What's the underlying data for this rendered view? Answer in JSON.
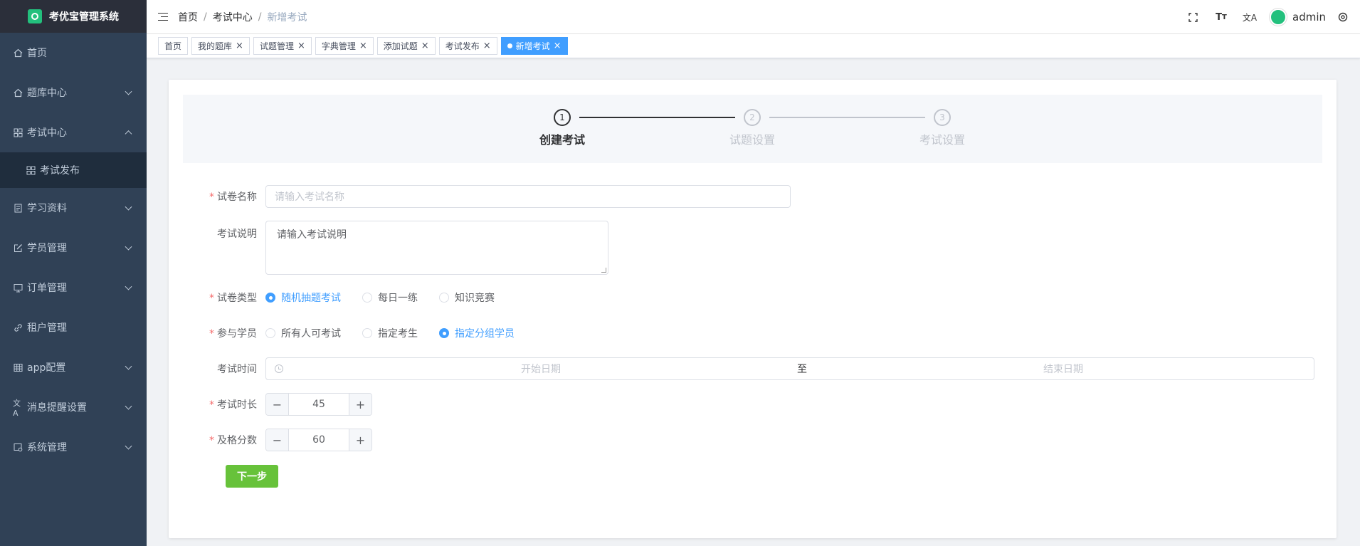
{
  "app": {
    "title": "考优宝管理系统"
  },
  "sidebar": {
    "items": [
      {
        "label": "首页",
        "icon": "home-icon"
      },
      {
        "label": "题库中心",
        "icon": "home-icon"
      },
      {
        "label": "考试中心",
        "icon": "grid-icon",
        "expanded": true
      },
      {
        "label": "考试发布",
        "icon": "grid-icon",
        "sub": true
      },
      {
        "label": "学习资料",
        "icon": "document-icon"
      },
      {
        "label": "学员管理",
        "icon": "edit-icon"
      },
      {
        "label": "订单管理",
        "icon": "monitor-icon"
      },
      {
        "label": "租户管理",
        "icon": "link-icon"
      },
      {
        "label": "app配置",
        "icon": "table-icon"
      },
      {
        "label": "消息提醒设置",
        "icon": "translate-icon"
      },
      {
        "label": "系统管理",
        "icon": "system-icon"
      }
    ]
  },
  "breadcrumb": [
    "首页",
    "考试中心",
    "新增考试"
  ],
  "topbar": {
    "username": "admin",
    "icons": [
      "fullscreen-icon",
      "font-size-icon",
      "translate-icon",
      "settings-icon"
    ]
  },
  "tags": [
    {
      "label": "首页",
      "closable": false
    },
    {
      "label": "我的题库",
      "closable": true
    },
    {
      "label": "试题管理",
      "closable": true
    },
    {
      "label": "字典管理",
      "closable": true
    },
    {
      "label": "添加试题",
      "closable": true
    },
    {
      "label": "考试发布",
      "closable": true
    },
    {
      "label": "新增考试",
      "closable": true,
      "active": true
    }
  ],
  "steps": [
    {
      "num": "1",
      "title": "创建考试",
      "active": true
    },
    {
      "num": "2",
      "title": "试题设置"
    },
    {
      "num": "3",
      "title": "考试设置"
    }
  ],
  "form": {
    "paper_name": {
      "label": "试卷名称",
      "placeholder": "请输入考试名称"
    },
    "exam_desc": {
      "label": "考试说明",
      "placeholder": "请输入考试说明"
    },
    "paper_type": {
      "label": "试卷类型",
      "options": [
        "随机抽题考试",
        "每日一练",
        "知识竞赛"
      ],
      "selected": 0
    },
    "participants": {
      "label": "参与学员",
      "options": [
        "所有人可考试",
        "指定考生",
        "指定分组学员"
      ],
      "selected": 2
    },
    "exam_time": {
      "label": "考试时间",
      "start_placeholder": "开始日期",
      "separator": "至",
      "end_placeholder": "结束日期"
    },
    "duration": {
      "label": "考试时长",
      "value": "45"
    },
    "pass_score": {
      "label": "及格分数",
      "value": "60"
    },
    "next_button": "下一步"
  },
  "colors": {
    "primary": "#409eff",
    "success": "#67c23a",
    "sidebar_bg": "#304156",
    "danger": "#f56c6c"
  }
}
